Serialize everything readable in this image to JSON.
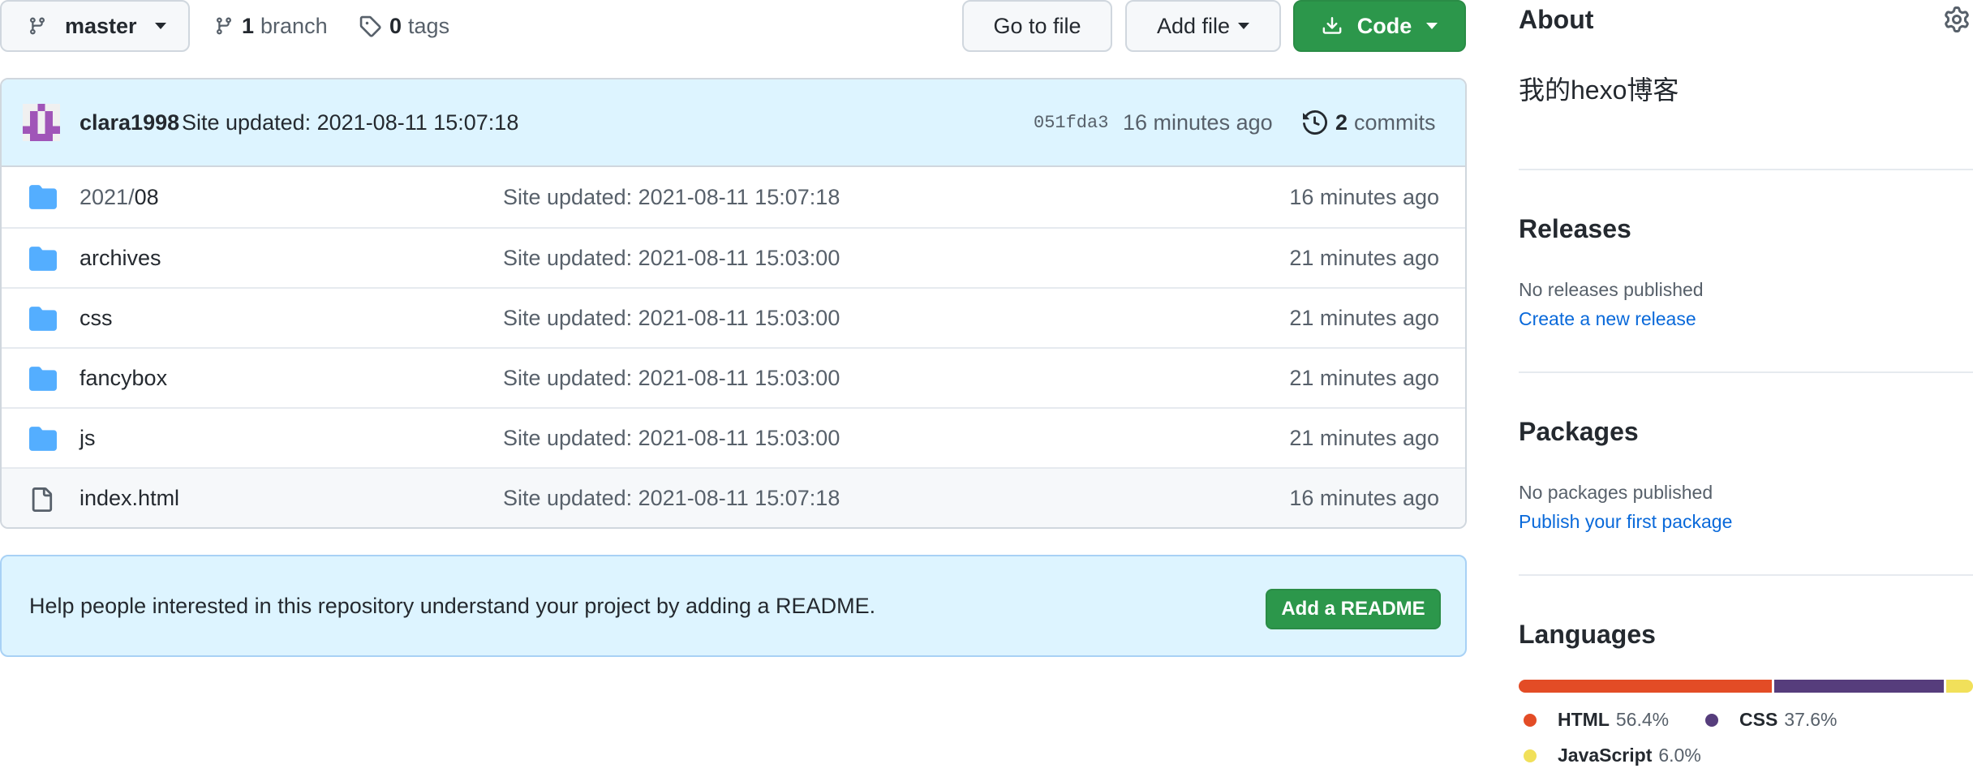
{
  "toolbar": {
    "branch_name": "master",
    "branch_count": "1",
    "branch_label": "branch",
    "tag_count": "0",
    "tag_label": "tags",
    "go_to_file": "Go to file",
    "add_file": "Add file",
    "code": "Code"
  },
  "commit": {
    "author": "clara1998",
    "message": "Site updated: 2021-08-11 15:07:18",
    "sha": "051fda3",
    "time": "16 minutes ago",
    "count": "2",
    "count_label": "commits"
  },
  "files": [
    {
      "type": "folder",
      "name_prefix": "2021/",
      "name": "08",
      "message": "Site updated: 2021-08-11 15:07:18",
      "age": "16 minutes ago"
    },
    {
      "type": "folder",
      "name_prefix": "",
      "name": "archives",
      "message": "Site updated: 2021-08-11 15:03:00",
      "age": "21 minutes ago"
    },
    {
      "type": "folder",
      "name_prefix": "",
      "name": "css",
      "message": "Site updated: 2021-08-11 15:03:00",
      "age": "21 minutes ago"
    },
    {
      "type": "folder",
      "name_prefix": "",
      "name": "fancybox",
      "message": "Site updated: 2021-08-11 15:03:00",
      "age": "21 minutes ago"
    },
    {
      "type": "folder",
      "name_prefix": "",
      "name": "js",
      "message": "Site updated: 2021-08-11 15:03:00",
      "age": "21 minutes ago"
    },
    {
      "type": "file",
      "name_prefix": "",
      "name": "index.html",
      "message": "Site updated: 2021-08-11 15:07:18",
      "age": "16 minutes ago"
    }
  ],
  "readme": {
    "text": "Help people interested in this repository understand your project by adding a README.",
    "button": "Add a README"
  },
  "sidebar": {
    "about_title": "About",
    "description": "我的hexo博客",
    "releases_title": "Releases",
    "releases_empty": "No releases published",
    "releases_link": "Create a new release",
    "packages_title": "Packages",
    "packages_empty": "No packages published",
    "packages_link": "Publish your first package",
    "languages_title": "Languages",
    "languages": [
      {
        "name": "HTML",
        "percent": "56.4%",
        "value": 56.4,
        "color": "#e34c26"
      },
      {
        "name": "CSS",
        "percent": "37.6%",
        "value": 37.6,
        "color": "#563d7c"
      },
      {
        "name": "JavaScript",
        "percent": "6.0%",
        "value": 6.0,
        "color": "#f1e05a"
      }
    ]
  },
  "colors": {
    "primary_green": "#2c974b",
    "link_blue": "#0969da",
    "folder_blue": "#54aeff",
    "commit_bar_bg": "#ddf4ff"
  }
}
